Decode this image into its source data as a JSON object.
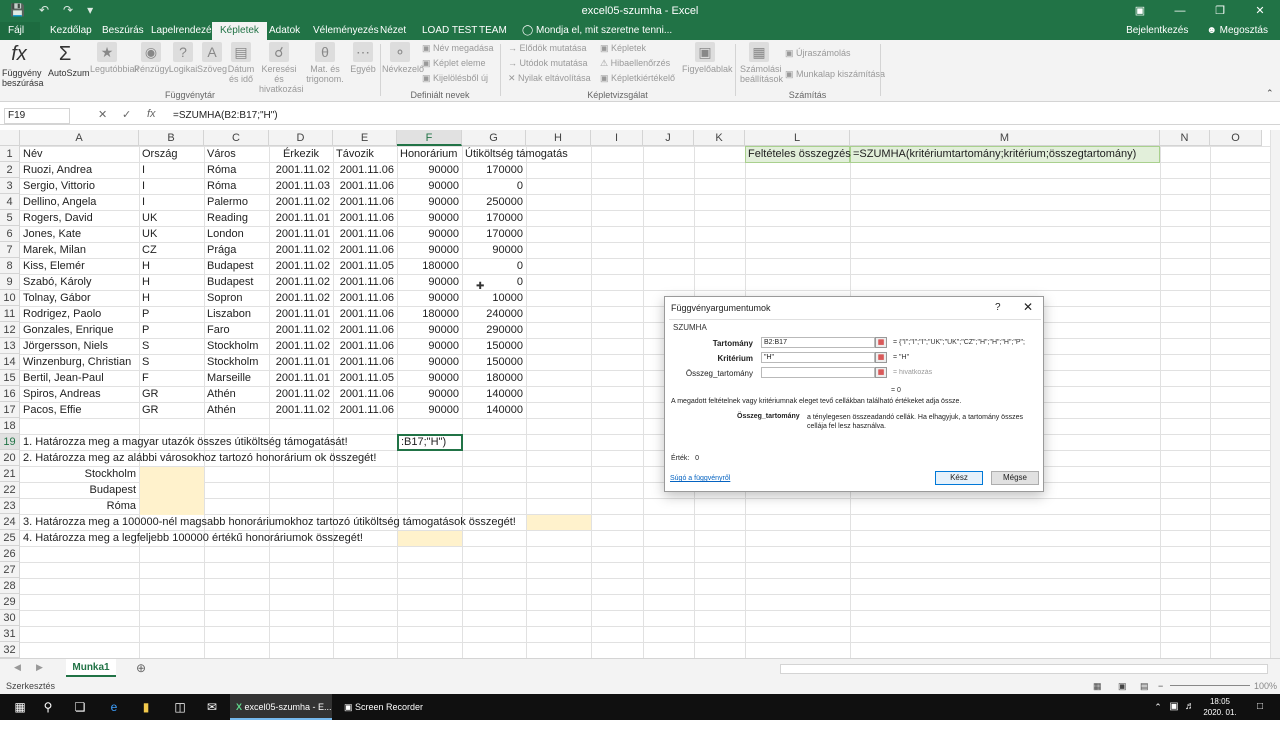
{
  "window": {
    "title": "excel05-szumha - Excel"
  },
  "ribbon_tabs": [
    "Fájl",
    "Kezdőlap",
    "Beszúrás",
    "Lapelrendezés",
    "Képletek",
    "Adatok",
    "Véleményezés",
    "Nézet",
    "LOAD TEST",
    "TEAM"
  ],
  "tellme": "Mondja el, mit szeretne tenni...",
  "signin": "Bejelentkezés",
  "share": "Megosztás",
  "ribbon": {
    "fuggveny": "Függvény beszúrása",
    "autoszum": "AutoSzum",
    "legutobbiak": "Legutóbbiak",
    "penzugyi": "Pénzügyi",
    "logikai": "Logikai",
    "szoveg": "Szöveg",
    "datum": "Dátum és idő",
    "kereses": "Keresési és hivatkozási",
    "mat": "Mat. és trigonom.",
    "egyeb": "Egyéb",
    "g_fuggvenytar": "Függvénytár",
    "nevkezelo": "Névkezelő",
    "nev_megadasa": "Név megadása",
    "keplet_eleme": "Képlet eleme",
    "kijelolesbol": "Kijelölésből új",
    "g_definialt": "Definiált nevek",
    "elodok": "Elődök mutatása",
    "utodok": "Utódok mutatása",
    "nyilak": "Nyilak eltávolítása",
    "kepletek": "Képletek",
    "hibaell": "Hibaellenőrzés",
    "kepletkiert": "Képletkiértékelő",
    "figyeloablak": "Figyelőablak",
    "g_kepletvizs": "Képletvizsgálat",
    "szamolasi": "Számolási beállítások",
    "ujraszamolas": "Újraszámolás",
    "munkalap": "Munkalap kiszámítása",
    "g_szamitas": "Számítás"
  },
  "formula_bar": {
    "namebox": "F19",
    "formula": "=SZUMHA(B2:B17;\"H\")"
  },
  "columns": [
    "A",
    "B",
    "C",
    "D",
    "E",
    "F",
    "G",
    "H",
    "I",
    "J",
    "K",
    "L",
    "M",
    "N",
    "O"
  ],
  "rows": [
    "1",
    "2",
    "3",
    "4",
    "5",
    "6",
    "7",
    "8",
    "9",
    "10",
    "11",
    "12",
    "13",
    "14",
    "15",
    "16",
    "17",
    "18",
    "19",
    "20",
    "21",
    "22",
    "23",
    "24",
    "25",
    "26",
    "27",
    "28",
    "29",
    "30",
    "31",
    "32"
  ],
  "headers": {
    "a": "Név",
    "b": "Ország",
    "c": "Város",
    "d": "Érkezik",
    "e": "Távozik",
    "f": "Honorárium",
    "g": "Útiköltség támogatás"
  },
  "data": [
    {
      "a": "Ruozi, Andrea",
      "b": "I",
      "c": "Róma",
      "d": "2001.11.02",
      "e": "2001.11.06",
      "f": "90000",
      "g": "170000"
    },
    {
      "a": "Sergio, Vittorio",
      "b": "I",
      "c": "Róma",
      "d": "2001.11.03",
      "e": "2001.11.06",
      "f": "90000",
      "g": "0"
    },
    {
      "a": "Dellino, Angela",
      "b": "I",
      "c": "Palermo",
      "d": "2001.11.02",
      "e": "2001.11.06",
      "f": "90000",
      "g": "250000"
    },
    {
      "a": "Rogers, David",
      "b": "UK",
      "c": "Reading",
      "d": "2001.11.01",
      "e": "2001.11.06",
      "f": "90000",
      "g": "170000"
    },
    {
      "a": "Jones, Kate",
      "b": "UK",
      "c": "London",
      "d": "2001.11.01",
      "e": "2001.11.06",
      "f": "90000",
      "g": "170000"
    },
    {
      "a": "Marek, Milan",
      "b": "CZ",
      "c": "Prága",
      "d": "2001.11.02",
      "e": "2001.11.06",
      "f": "90000",
      "g": "90000"
    },
    {
      "a": "Kiss, Elemér",
      "b": "H",
      "c": "Budapest",
      "d": "2001.11.02",
      "e": "2001.11.05",
      "f": "180000",
      "g": "0"
    },
    {
      "a": "Szabó, Károly",
      "b": "H",
      "c": "Budapest",
      "d": "2001.11.02",
      "e": "2001.11.06",
      "f": "90000",
      "g": "0"
    },
    {
      "a": "Tolnay, Gábor",
      "b": "H",
      "c": "Sopron",
      "d": "2001.11.02",
      "e": "2001.11.06",
      "f": "90000",
      "g": "10000"
    },
    {
      "a": "Rodrigez, Paolo",
      "b": "P",
      "c": "Liszabon",
      "d": "2001.11.01",
      "e": "2001.11.06",
      "f": "180000",
      "g": "240000"
    },
    {
      "a": "Gonzales, Enrique",
      "b": "P",
      "c": "Faro",
      "d": "2001.11.02",
      "e": "2001.11.06",
      "f": "90000",
      "g": "290000"
    },
    {
      "a": "Jörgersson, Niels",
      "b": "S",
      "c": "Stockholm",
      "d": "2001.11.02",
      "e": "2001.11.06",
      "f": "90000",
      "g": "150000"
    },
    {
      "a": "Winzenburg, Christian",
      "b": "S",
      "c": "Stockholm",
      "d": "2001.11.01",
      "e": "2001.11.06",
      "f": "90000",
      "g": "150000"
    },
    {
      "a": "Bertil, Jean-Paul",
      "b": "F",
      "c": "Marseille",
      "d": "2001.11.01",
      "e": "2001.11.05",
      "f": "90000",
      "g": "180000"
    },
    {
      "a": "Spiros, Andreas",
      "b": "GR",
      "c": "Athén",
      "d": "2001.11.02",
      "e": "2001.11.06",
      "f": "90000",
      "g": "140000"
    },
    {
      "a": "Pacos, Effie",
      "b": "GR",
      "c": "Athén",
      "d": "2001.11.02",
      "e": "2001.11.06",
      "f": "90000",
      "g": "140000"
    }
  ],
  "l1": "Feltételes összegzés",
  "m1": "=SZUMHA(kritériumtartomány;kritérium;összegtartomány)",
  "tasks": {
    "t1": "1. Határozza meg a magyar utazók összes útiköltség támogatását!",
    "t2": "2. Határozza meg az alábbi városokhoz tartozó honorárium ok összegét!",
    "c21": "Stockholm",
    "c22": "Budapest",
    "c23": "Róma",
    "t3": "3. Határozza meg a 100000-nél magsabb honoráriumokhoz tartozó útiköltség támogatások összegét!",
    "t4": "4. Határozza meg a legfeljebb 100000 értékű honoráriumok összegét!"
  },
  "active_cell_text": ":B17;\"H\")",
  "sheet": "Munka1",
  "status": "Szerkesztés",
  "zoom": "100%",
  "taskbar": {
    "excel": "excel05-szumha - E...",
    "recorder": "Screen Recorder",
    "time": "18:05",
    "date": "2020. 01. 06."
  },
  "dialog": {
    "title": "Függvényargumentumok",
    "fn": "SZUMHA",
    "arg1_label": "Tartomány",
    "arg1_value": "B2:B17",
    "arg1_result": "{\"I\";\"I\";\"I\";\"UK\";\"UK\";\"CZ\";\"H\";\"H\";\"H\";\"P\";",
    "arg2_label": "Kritérium",
    "arg2_value": "\"H\"",
    "arg2_result": "\"H\"",
    "arg3_label": "Összeg_tartomány",
    "arg3_value": "",
    "arg3_result": "hivatkozás",
    "eq": "=",
    "total": "0",
    "desc": "A megadott feltételnek vagy kritériumnak eleget tevő cellákban található értékeket adja össze.",
    "argname": "Összeg_tartomány",
    "argdesc": "a ténylegesen összeadandó cellák. Ha elhagyjuk, a tartomány összes cellája fel lesz használva.",
    "ertek_label": "Érték:",
    "ertek": "0",
    "help": "Súgó a függvényről",
    "ok": "Kész",
    "cancel": "Mégse"
  }
}
